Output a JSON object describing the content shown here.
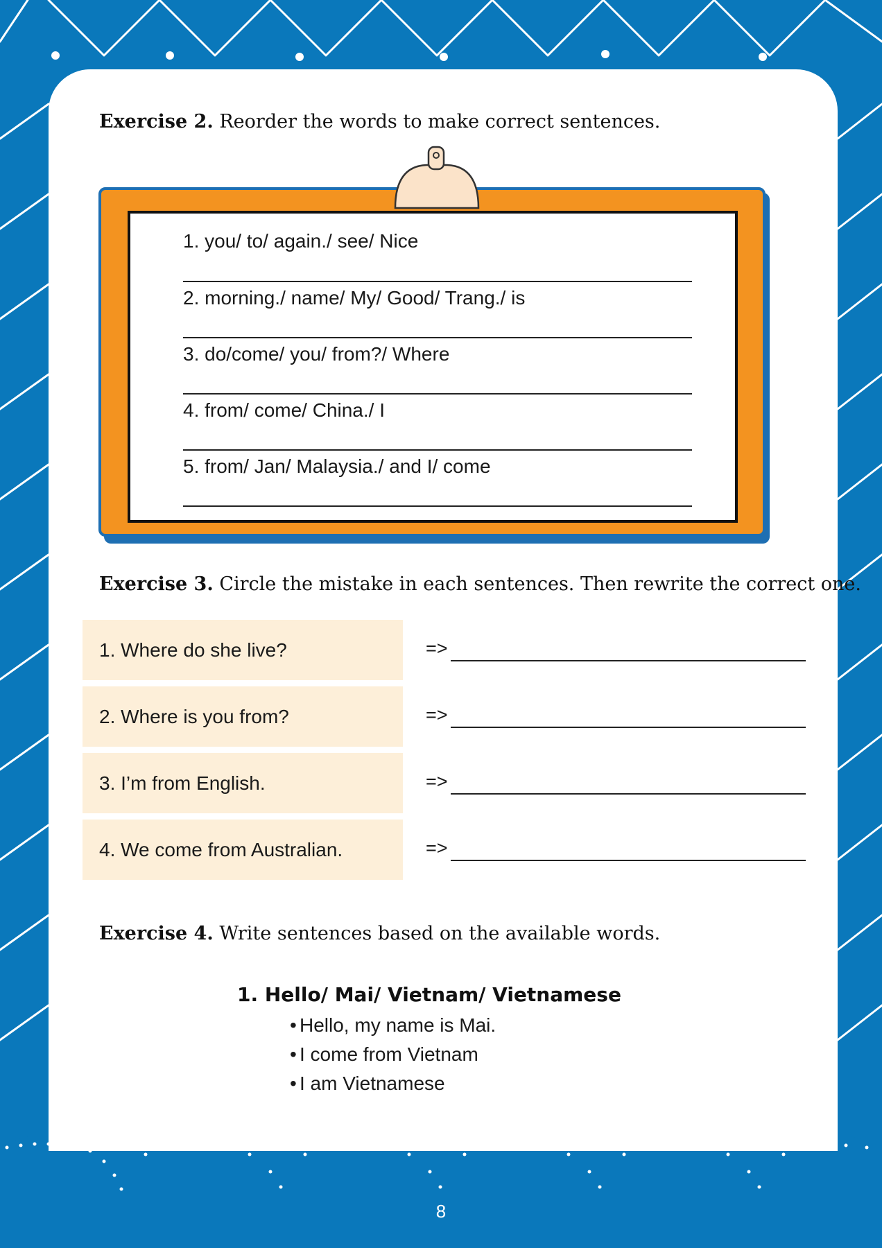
{
  "exercise2": {
    "label": "Exercise 2.",
    "instruction": "Reorder the words to make correct sentences.",
    "items": [
      "1. you/ to/ again./ see/ Nice",
      "2. morning./ name/ My/ Good/ Trang./ is",
      "3. do/come/ you/ from?/ Where",
      "4. from/ come/ China./ I",
      "5. from/ Jan/ Malaysia./ and I/ come"
    ]
  },
  "exercise3": {
    "label": "Exercise 3.",
    "instruction": "Circle the mistake in each sentences. Then rewrite the correct one.",
    "answer_prefix": "=>",
    "items": [
      "1. Where do she live?",
      "2. Where is you from?",
      "3. I’m from English.",
      "4. We come from Australian."
    ]
  },
  "exercise4": {
    "label": "Exercise 4.",
    "instruction": "Write sentences based on the available words.",
    "prompt": "1. Hello/ Mai/ Vietnam/ Vietnamese",
    "bullet": "•",
    "example_lines": [
      "Hello, my name is Mai.",
      "I come from Vietnam",
      "I am Vietnamese"
    ]
  },
  "page_number": "8",
  "colors": {
    "background_blue": "#0a78bb",
    "board_orange": "#f39320",
    "box_cream": "#fdefd9"
  }
}
